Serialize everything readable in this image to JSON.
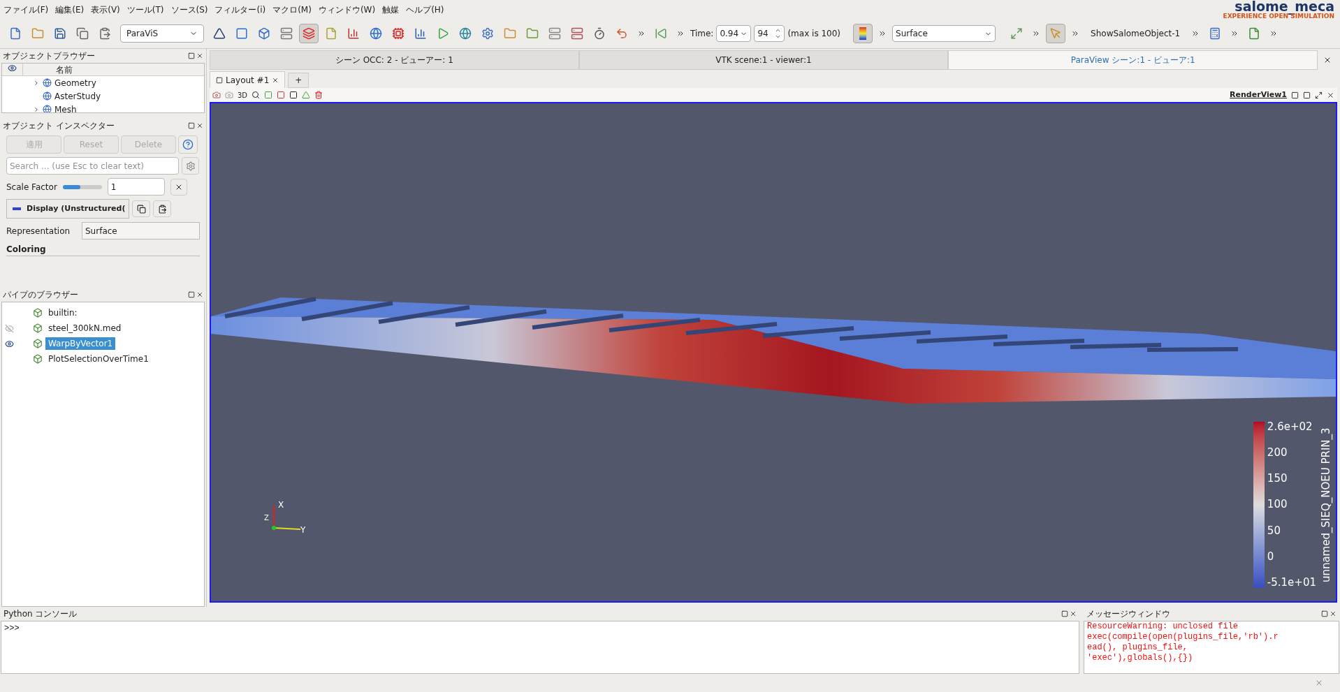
{
  "menu": [
    "ファイル(F)",
    "編集(E)",
    "表示(V)",
    "ツール(T)",
    "ソース(S)",
    "フィルター(i)",
    "マクロ(M)",
    "ウィンドウ(W)",
    "触媒",
    "ヘルプ(H)"
  ],
  "logo": {
    "name": "salome_meca",
    "tagline": "EXPERIENCE OPEN SIMULATION"
  },
  "toolbar": {
    "module": "ParaViS",
    "time_label": "Time:",
    "time_value": "0.94",
    "step": "94",
    "max_label": "(max is 100)",
    "representation": "Surface",
    "show_object": "ShowSalomeObject-1"
  },
  "object_browser": {
    "title": "オブジェクトブラウザー",
    "column": "名前",
    "items": [
      {
        "label": "Geometry",
        "expandable": true
      },
      {
        "label": "AsterStudy",
        "expandable": false
      },
      {
        "label": "Mesh",
        "expandable": true
      }
    ]
  },
  "inspector": {
    "title": "オブジェクト インスペクター",
    "buttons": [
      {
        "label": "適用",
        "disabled": true
      },
      {
        "label": "Reset",
        "disabled": true
      },
      {
        "label": "Delete",
        "disabled": true
      }
    ],
    "search_placeholder": "Search ... (use Esc to clear text)",
    "scale_label": "Scale Factor",
    "scale_slider": {
      "level": 0.45
    },
    "scale_value": "1",
    "display": "Display (Unstructured(",
    "representation_label": "Representation",
    "representation": "Surface",
    "section": "Coloring"
  },
  "pipeline": {
    "title": "パイプのブラウザー",
    "items": [
      {
        "label": "builtin:",
        "kind": "plain",
        "selected": false
      },
      {
        "label": "steel_300kN.med",
        "kind": "hidden",
        "selected": false
      },
      {
        "label": "WarpByVector1",
        "kind": "shown",
        "selected": true
      },
      {
        "label": "PlotSelectionOverTime1",
        "kind": "plain",
        "selected": false
      }
    ]
  },
  "view_tabs": [
    {
      "label": "シーン OCC: 2 - ビューアー: 1",
      "selected": false
    },
    {
      "label": "VTK scene:1 - viewer:1",
      "selected": false
    },
    {
      "label": "ParaView シーン:1 - ビューア:1",
      "selected": true
    }
  ],
  "layout_tabs": {
    "tab": "Layout #1",
    "add": "+"
  },
  "view_toolbar": {
    "mode": "3D",
    "view_name": "RenderView1"
  },
  "legend": {
    "title": "unnamed_SIEQ_NOEU PRIN_3",
    "ticks": [
      "2.6e+02",
      "200",
      "150",
      "100",
      "50",
      "0",
      "-5.1e+01"
    ]
  },
  "axes": {
    "x": "X",
    "y": "Y",
    "z": "Z"
  },
  "python_console": {
    "title": "Python コンソール",
    "prompt": ">>>"
  },
  "messages": {
    "title": "メッセージウィンドウ",
    "lines": [
      "ResourceWarning: unclosed file",
      "exec(compile(open(plugins_file,'rb').r",
      "ead(), plugins_file,",
      "'exec'),globals(),{})"
    ]
  }
}
